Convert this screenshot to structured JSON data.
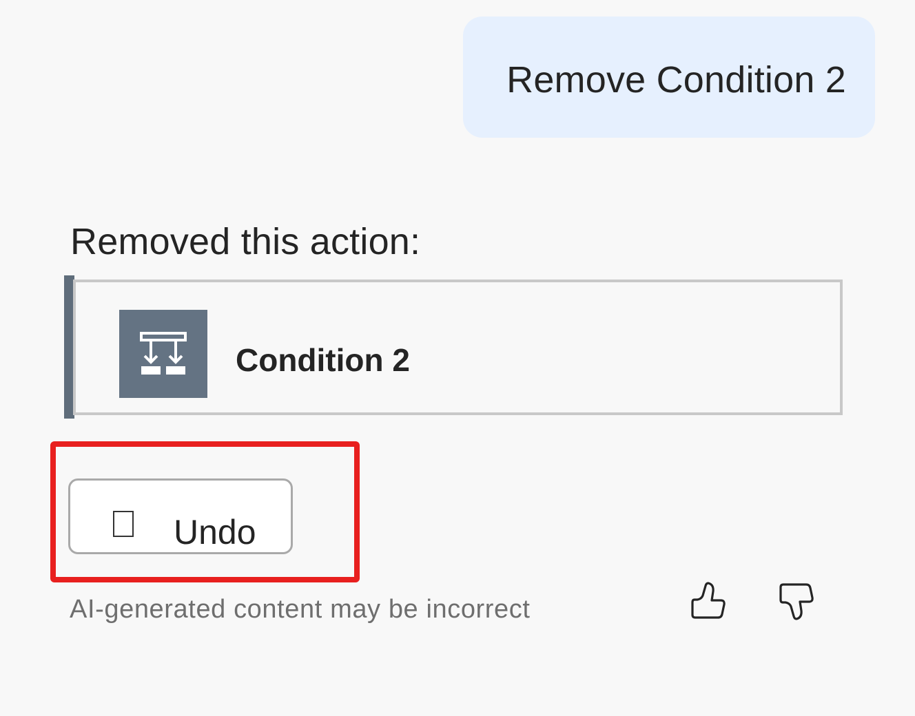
{
  "user_message": {
    "text": "Remove Condition 2"
  },
  "response": {
    "heading": "Removed this action:",
    "action_card": {
      "icon": "condition-branch-icon",
      "title": "Condition 2"
    },
    "undo_button": {
      "icon": "undo-icon",
      "label": "Undo"
    },
    "disclaimer": "AI-generated content may be incorrect",
    "feedback": {
      "like_icon": "thumbs-up-icon",
      "dislike_icon": "thumbs-down-icon"
    }
  },
  "colors": {
    "background": "#f8f8f8",
    "user_bubble": "#e6f0fe",
    "action_accent": "#5f6d7b",
    "action_icon_tile": "#647383",
    "highlight": "#e8201f"
  }
}
